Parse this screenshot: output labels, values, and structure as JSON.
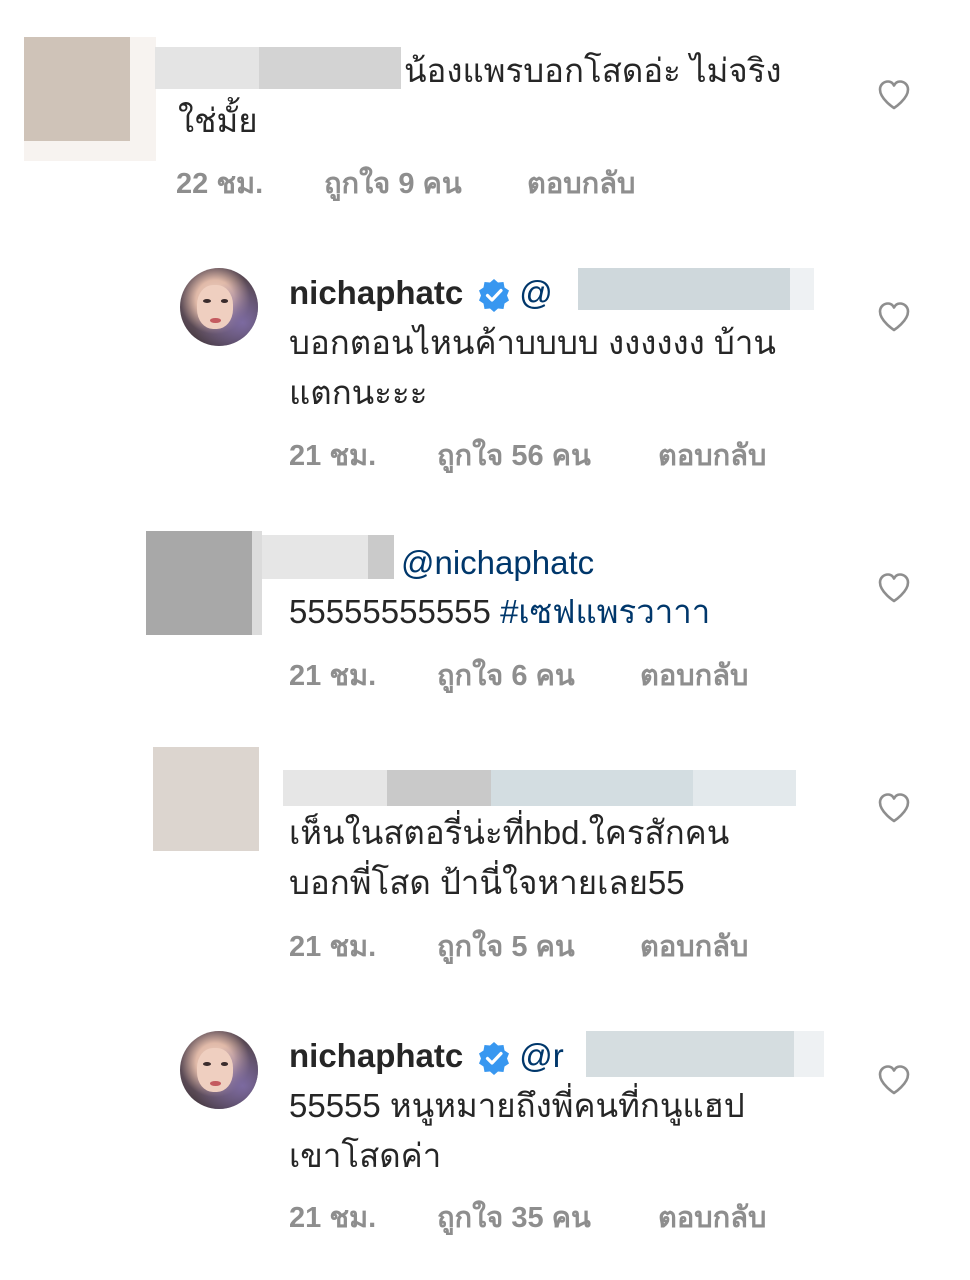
{
  "comments": [
    {
      "text_line1": "น้องแพรบอกโสดอ่ะ ไม่จริง",
      "text_line2": "ใช่มั้ย",
      "time": "22 ชม.",
      "likes": "ถูกใจ 9 คน",
      "reply": "ตอบกลับ"
    },
    {
      "username": "nichaphatc",
      "mention_prefix": "@",
      "text_line1": "บอกตอนไหนค้าบบบบ งงงงงง บ้าน",
      "text_line2": "แตกนะะะ",
      "time": "21 ชม.",
      "likes": "ถูกใจ 56 คน",
      "reply": "ตอบกลับ"
    },
    {
      "mention": "@nichaphatc",
      "text_line1_plain": "55555555555 ",
      "hashtag": "#เซฟแพรวาาา",
      "time": "21 ชม.",
      "likes": "ถูกใจ 6 คน",
      "reply": "ตอบกลับ"
    },
    {
      "text_line1": "เห็นในสตอรี่น่ะที่hbd.ใครสักคน",
      "text_line2": "บอกพี่โสด ป้านี่ใจหายเลย55",
      "time": "21 ชม.",
      "likes": "ถูกใจ 5 คน",
      "reply": "ตอบกลับ"
    },
    {
      "username": "nichaphatc",
      "mention_prefix": "@r",
      "text_line1": "55555 หนูหมายถึงพี่คนที่กนูแฮป",
      "text_line2": "เขาโสดค่า",
      "time": "21 ชม.",
      "likes": "ถูกใจ 35 คน",
      "reply": "ตอบกลับ"
    }
  ],
  "icons": {
    "heart": "heart-outline-icon",
    "verified": "verified-badge-icon"
  },
  "colors": {
    "text": "#262626",
    "meta": "#8e8e8e",
    "link": "#00376b",
    "verified": "#3897f0"
  }
}
